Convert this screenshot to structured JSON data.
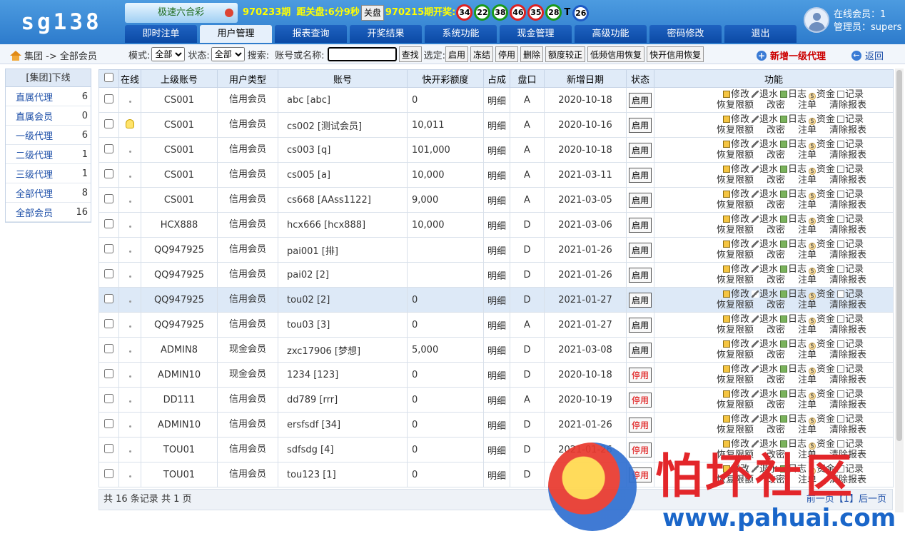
{
  "app": {
    "logo": "sg138"
  },
  "lottery": {
    "tab_label": "极速六合彩",
    "period": "970233期",
    "countdown_label": "距关盘:",
    "countdown": "6分9秒",
    "close_btn": "关盘",
    "last_period": "970215期开奖:",
    "balls": [
      "34",
      "22",
      "38",
      "46",
      "35",
      "28"
    ],
    "ball_colors": [
      "red",
      "green",
      "green",
      "red",
      "red",
      "green"
    ],
    "t_label": "T",
    "special": "26"
  },
  "nav": [
    "即时注单",
    "用户管理",
    "报表查询",
    "开奖结果",
    "系统功能",
    "现金管理",
    "高级功能",
    "密码修改",
    "退出"
  ],
  "user": {
    "online": "在线会员：1",
    "admin": "管理员：supers"
  },
  "toolbar": {
    "crumb": "集团 -> 全部会员",
    "mode_label": "模式:",
    "mode_value": "全部",
    "status_label": "状态:",
    "status_value": "全部",
    "search_label": "搜索:",
    "account_label": "账号或名称:",
    "search_btn": "查找",
    "selected_label": "选定:",
    "actions": [
      "启用",
      "冻结",
      "停用",
      "删除",
      "额度较正",
      "低频信用恢复",
      "快开信用恢复"
    ],
    "add_label": "新增一级代理",
    "back_label": "返回"
  },
  "sidebar": {
    "title": "[集团]下线",
    "items": [
      {
        "label": "直属代理",
        "count": "6"
      },
      {
        "label": "直属会员",
        "count": "0"
      },
      {
        "label": "一级代理",
        "count": "6"
      },
      {
        "label": "二级代理",
        "count": "1"
      },
      {
        "label": "三级代理",
        "count": "1"
      },
      {
        "label": "全部代理",
        "count": "8"
      },
      {
        "label": "全部会员",
        "count": "16"
      }
    ]
  },
  "table": {
    "headers": [
      "在线",
      "上级账号",
      "用户类型",
      "账号",
      "快开彩额度",
      "占成",
      "盘口",
      "新增日期",
      "状态",
      "功能"
    ],
    "func_labels": [
      "修改",
      "退水",
      "日志",
      "资金",
      "记录",
      "恢复限额",
      "改密",
      "注单",
      "清除报表"
    ],
    "rows": [
      {
        "online": false,
        "parent": "CS001",
        "type": "信用会员",
        "account": "abc [abc]",
        "quota": "0",
        "share": "明细",
        "plate": "A",
        "date": "2020-10-18",
        "status": "启用",
        "status_color": "normal"
      },
      {
        "online": true,
        "parent": "CS001",
        "type": "信用会员",
        "account": "cs002 [测试会员]",
        "quota": "10,011",
        "share": "明细",
        "plate": "A",
        "date": "2020-10-16",
        "status": "启用",
        "status_color": "normal"
      },
      {
        "online": false,
        "parent": "CS001",
        "type": "信用会员",
        "account": "cs003 [q]",
        "quota": "101,000",
        "share": "明细",
        "plate": "A",
        "date": "2020-10-18",
        "status": "启用",
        "status_color": "normal"
      },
      {
        "online": false,
        "parent": "CS001",
        "type": "信用会员",
        "account": "cs005 [a]",
        "quota": "10,000",
        "share": "明细",
        "plate": "A",
        "date": "2021-03-11",
        "status": "启用",
        "status_color": "normal"
      },
      {
        "online": false,
        "parent": "CS001",
        "type": "信用会员",
        "account": "cs668 [AAss1122]",
        "quota": "9,000",
        "share": "明细",
        "plate": "A",
        "date": "2021-03-05",
        "status": "启用",
        "status_color": "normal"
      },
      {
        "online": false,
        "parent": "HCX888",
        "type": "信用会员",
        "account": "hcx666 [hcx888]",
        "quota": "10,000",
        "share": "明细",
        "plate": "D",
        "date": "2021-03-06",
        "status": "启用",
        "status_color": "normal"
      },
      {
        "online": false,
        "parent": "QQ947925",
        "type": "信用会员",
        "account": "pai001 [排]",
        "quota": "",
        "share": "明细",
        "plate": "D",
        "date": "2021-01-26",
        "status": "启用",
        "status_color": "normal"
      },
      {
        "online": false,
        "parent": "QQ947925",
        "type": "信用会员",
        "account": "pai02 [2]",
        "quota": "",
        "share": "明细",
        "plate": "D",
        "date": "2021-01-26",
        "status": "启用",
        "status_color": "normal"
      },
      {
        "online": false,
        "parent": "QQ947925",
        "type": "信用会员",
        "account": "tou02 [2]",
        "quota": "0",
        "share": "明细",
        "plate": "D",
        "date": "2021-01-27",
        "status": "启用",
        "status_color": "normal",
        "highlight": true
      },
      {
        "online": false,
        "parent": "QQ947925",
        "type": "信用会员",
        "account": "tou03 [3]",
        "quota": "0",
        "share": "明细",
        "plate": "A",
        "date": "2021-01-27",
        "status": "启用",
        "status_color": "normal"
      },
      {
        "online": false,
        "parent": "ADMIN8",
        "type": "现金会员",
        "account": "zxc17906 [梦想]",
        "quota": "5,000",
        "share": "明细",
        "plate": "D",
        "date": "2021-03-08",
        "status": "启用",
        "status_color": "normal"
      },
      {
        "online": false,
        "parent": "ADMIN10",
        "type": "现金会员",
        "account": "1234 [123]",
        "quota": "0",
        "share": "明细",
        "plate": "D",
        "date": "2020-10-18",
        "status": "停用",
        "status_color": "red"
      },
      {
        "online": false,
        "parent": "DD111",
        "type": "信用会员",
        "account": "dd789 [rrr]",
        "quota": "0",
        "share": "明细",
        "plate": "A",
        "date": "2020-10-19",
        "status": "停用",
        "status_color": "red"
      },
      {
        "online": false,
        "parent": "ADMIN10",
        "type": "信用会员",
        "account": "ersfsdf [34]",
        "quota": "0",
        "share": "明细",
        "plate": "D",
        "date": "2021-01-26",
        "status": "停用",
        "status_color": "red"
      },
      {
        "online": false,
        "parent": "TOU01",
        "type": "信用会员",
        "account": "sdfsdg [4]",
        "quota": "0",
        "share": "明细",
        "plate": "D",
        "date": "2021-01-26",
        "status": "停用",
        "status_color": "red"
      },
      {
        "online": false,
        "parent": "TOU01",
        "type": "信用会员",
        "account": "tou123 [1]",
        "quota": "0",
        "share": "明细",
        "plate": "D",
        "date": "",
        "status": "停用",
        "status_color": "red"
      }
    ]
  },
  "footer": {
    "summary": "共 16 条记录 共 1 页",
    "pager": "前一页【1】后一页"
  },
  "watermark": {
    "title": "怕坏社区",
    "url": "www.pahuai.com"
  }
}
